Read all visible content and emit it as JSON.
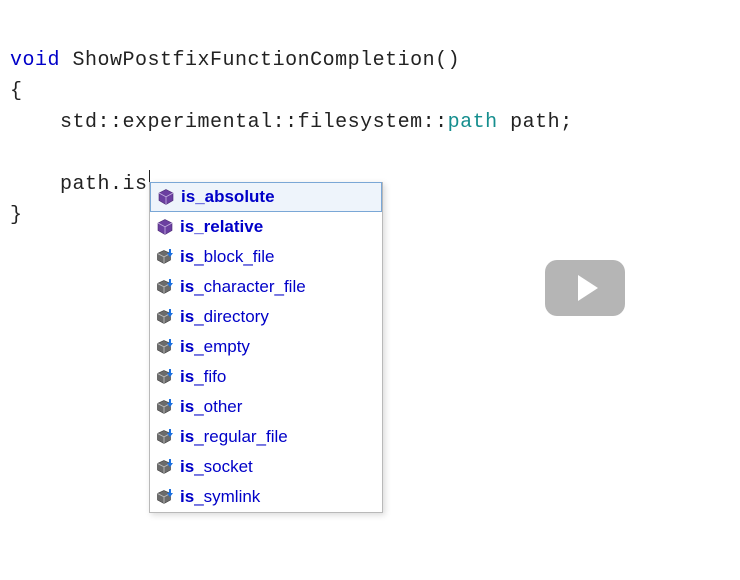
{
  "code": {
    "line1": {
      "keyword": "void",
      "funcName": "ShowPostfixFunctionCompletion",
      "parens": "()"
    },
    "line2": "{",
    "line3": {
      "indent": "    ",
      "ns1": "std",
      "sep1": "::",
      "ns2": "experimental",
      "sep2": "::",
      "ns3": "filesystem",
      "sep3": "::",
      "type": "path",
      "space": " ",
      "varName": "path",
      "semi": ";"
    },
    "line5": {
      "indent": "    ",
      "obj": "path",
      "dot": ".",
      "typed": "is"
    },
    "line6": "}"
  },
  "completion": {
    "typedPrefix": "is",
    "items": [
      {
        "kind": "method",
        "prefix": "is",
        "rest": "_absolute",
        "selected": true,
        "bold": true
      },
      {
        "kind": "method",
        "prefix": "is",
        "rest": "_relative",
        "selected": false,
        "bold": true
      },
      {
        "kind": "ext",
        "prefix": "is",
        "rest": "_block_file",
        "selected": false,
        "bold": false
      },
      {
        "kind": "ext",
        "prefix": "is",
        "rest": "_character_file",
        "selected": false,
        "bold": false
      },
      {
        "kind": "ext",
        "prefix": "is",
        "rest": "_directory",
        "selected": false,
        "bold": false
      },
      {
        "kind": "ext",
        "prefix": "is",
        "rest": "_empty",
        "selected": false,
        "bold": false
      },
      {
        "kind": "ext",
        "prefix": "is",
        "rest": "_fifo",
        "selected": false,
        "bold": false
      },
      {
        "kind": "ext",
        "prefix": "is",
        "rest": "_other",
        "selected": false,
        "bold": false
      },
      {
        "kind": "ext",
        "prefix": "is",
        "rest": "_regular_file",
        "selected": false,
        "bold": false
      },
      {
        "kind": "ext",
        "prefix": "is",
        "rest": "_socket",
        "selected": false,
        "bold": false
      },
      {
        "kind": "ext",
        "prefix": "is",
        "rest": "_symlink",
        "selected": false,
        "bold": false
      }
    ]
  },
  "colors": {
    "keyword": "#0000c8",
    "type": "#158e8e",
    "completionText": "#0000c8",
    "selectionBg": "#eef4fb",
    "selectionBorder": "#7aa7d6"
  }
}
